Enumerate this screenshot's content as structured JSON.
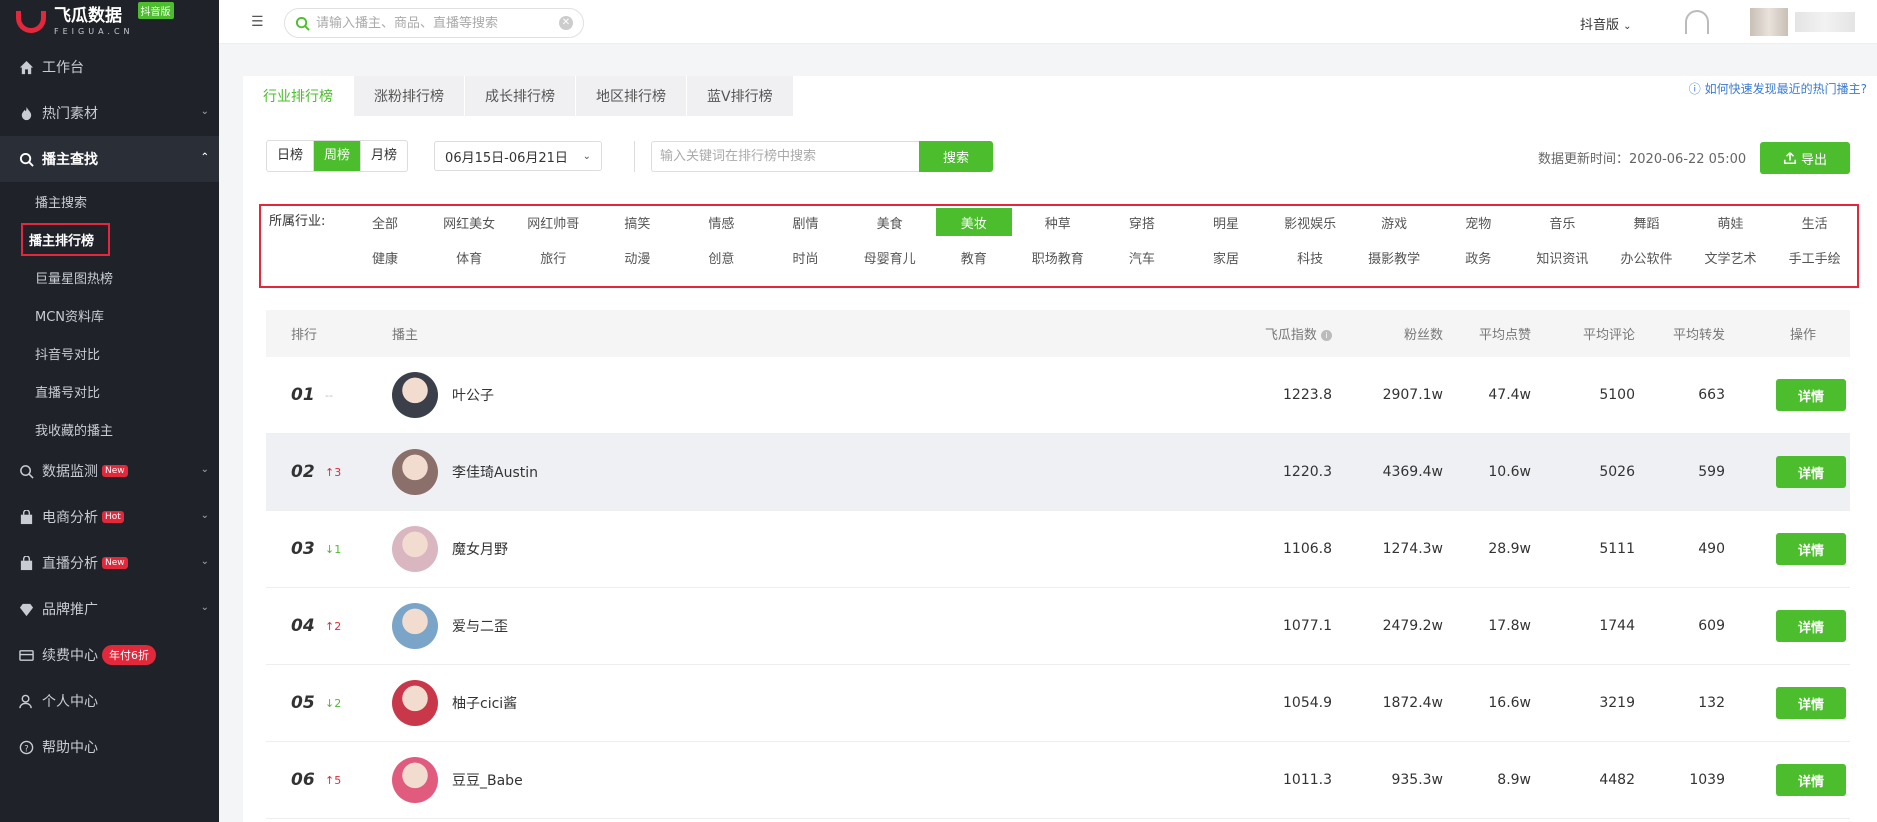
{
  "brand": {
    "name_cn": "飞瓜数据",
    "name_en": "FEIGUA.CN",
    "badge": "抖音版",
    "color": "#e2283a"
  },
  "sidebar": {
    "items": [
      {
        "label": "工作台",
        "icon": "home-icon"
      },
      {
        "label": "热门素材",
        "icon": "fire-icon"
      },
      {
        "label": "播主查找",
        "icon": "search-icon"
      },
      {
        "label": "数据监测",
        "icon": "monitor-icon",
        "badge": "New"
      },
      {
        "label": "电商分析",
        "icon": "bag-icon",
        "badge": "Hot"
      },
      {
        "label": "直播分析",
        "icon": "live-icon",
        "badge": "New"
      },
      {
        "label": "品牌推广",
        "icon": "diamond-icon"
      },
      {
        "label": "续费中心",
        "icon": "card-icon",
        "badge": "年付6折"
      },
      {
        "label": "个人中心",
        "icon": "user-icon"
      },
      {
        "label": "帮助中心",
        "icon": "help-icon"
      }
    ],
    "sub_items": [
      "播主搜索",
      "播主排行榜",
      "巨量星图热榜",
      "MCN资料库",
      "抖音号对比",
      "直播号对比",
      "我收藏的播主"
    ]
  },
  "header": {
    "search_placeholder": "请输入播主、商品、直播等搜索",
    "version": "抖音版"
  },
  "tabs": [
    "行业排行榜",
    "涨粉排行榜",
    "成长排行榜",
    "地区排行榜",
    "蓝V排行榜"
  ],
  "help_link": "如何快速发现最近的热门播主?",
  "filters": {
    "periods": [
      "日榜",
      "周榜",
      "月榜"
    ],
    "date_range": "06月15日-06月21日",
    "keyword_placeholder": "输入关键词在排行榜中搜索",
    "search_button": "搜索",
    "update_time": "数据更新时间：2020-06-22 05:00",
    "export_button": "导出"
  },
  "industry": {
    "label": "所属行业:",
    "options": [
      "全部",
      "网红美女",
      "网红帅哥",
      "搞笑",
      "情感",
      "剧情",
      "美食",
      "美妆",
      "种草",
      "穿搭",
      "明星",
      "影视娱乐",
      "游戏",
      "宠物",
      "音乐",
      "舞蹈",
      "萌娃",
      "生活",
      "健康",
      "体育",
      "旅行",
      "动漫",
      "创意",
      "时尚",
      "母婴育儿",
      "教育",
      "职场教育",
      "汽车",
      "家居",
      "科技",
      "摄影教学",
      "政务",
      "知识资讯",
      "办公软件",
      "文学艺术",
      "手工手绘"
    ]
  },
  "table": {
    "headers": {
      "rank": "排行",
      "host": "播主",
      "index": "飞瓜指数",
      "fans": "粉丝数",
      "likes": "平均点赞",
      "comments": "平均评论",
      "forwards": "平均转发",
      "op": "操作"
    },
    "detail_label": "详情",
    "rows": [
      {
        "rank": "01",
        "change": "--",
        "dir": "same",
        "name": "叶公子",
        "index": "1223.8",
        "fans": "2907.1w",
        "likes": "47.4w",
        "comments": "5100",
        "forwards": "663"
      },
      {
        "rank": "02",
        "change": "↑3",
        "dir": "up",
        "name": "李佳琦Austin",
        "index": "1220.3",
        "fans": "4369.4w",
        "likes": "10.6w",
        "comments": "5026",
        "forwards": "599"
      },
      {
        "rank": "03",
        "change": "↓1",
        "dir": "down",
        "name": "魔女月野",
        "index": "1106.8",
        "fans": "1274.3w",
        "likes": "28.9w",
        "comments": "5111",
        "forwards": "490"
      },
      {
        "rank": "04",
        "change": "↑2",
        "dir": "up",
        "name": "爱与二歪",
        "index": "1077.1",
        "fans": "2479.2w",
        "likes": "17.8w",
        "comments": "1744",
        "forwards": "609"
      },
      {
        "rank": "05",
        "change": "↓2",
        "dir": "down",
        "name": "柚子cici酱",
        "index": "1054.9",
        "fans": "1872.4w",
        "likes": "16.6w",
        "comments": "3219",
        "forwards": "132"
      },
      {
        "rank": "06",
        "change": "↑5",
        "dir": "up",
        "name": "豆豆_Babe",
        "index": "1011.3",
        "fans": "935.3w",
        "likes": "8.9w",
        "comments": "4482",
        "forwards": "1039"
      }
    ]
  }
}
